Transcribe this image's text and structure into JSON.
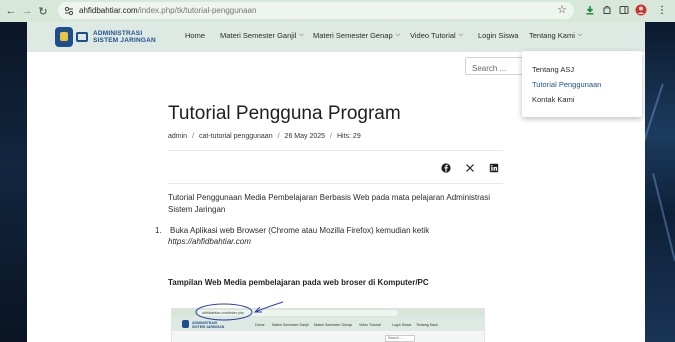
{
  "browser": {
    "url_host": "ahfidbahtiar.com",
    "url_path": "/index.php/tk/tutorial-penggunaan"
  },
  "site": {
    "logo_line1": "ADMINISTRASI",
    "logo_line2": "SISTEM JARINGAN",
    "menu": [
      {
        "label": "Home"
      },
      {
        "label": "Materi Semester Ganjil"
      },
      {
        "label": "Materi Semester Genap"
      },
      {
        "label": "Video Tutorial"
      },
      {
        "label": "Login Siswa"
      },
      {
        "label": "Tentang Kami"
      }
    ],
    "search_placeholder": "Search ...",
    "dropdown": [
      {
        "label": "Tentang ASJ"
      },
      {
        "label": "Tutorial Penggunaan"
      },
      {
        "label": "Kontak Kami"
      }
    ]
  },
  "article": {
    "title": "Tutorial Pengguna Program",
    "meta": {
      "author": "admin",
      "category": "cat-tutorial penggunaan",
      "date": "26 May 2025",
      "hits": "Hits: 29"
    },
    "intro": "Tutorial Penggunaan Media Pembelajaran Berbasis Web pada mata pelajaran Administrasi Sistem Jaringan",
    "list_number": "1.",
    "list_text": "Buka Aplikasi web Browser (Chrome atau Mozilla Firefox) kemudian ketik",
    "list_link": "https://ahfidbahtiar.com",
    "subhead": "Tampilan Web Media pembelajaran pada web broser di  Komputer/PC"
  },
  "screenshot": {
    "url": "ahfidbahtiar.com/index.php",
    "logo_line1": "ADMINISTRASI",
    "logo_line2": "SISTEM JARINGAN",
    "menu": [
      "Home",
      "Materi Semester Ganjil",
      "Materi Semester Genap",
      "Video Tutorial",
      "Login Siswa",
      "Tentang Kami"
    ],
    "search_placeholder": "Search ..."
  },
  "colors": {
    "header_bg": "#dfe9e3",
    "brand": "#1d4f8e",
    "chrome_bg": "#d7e7da"
  }
}
